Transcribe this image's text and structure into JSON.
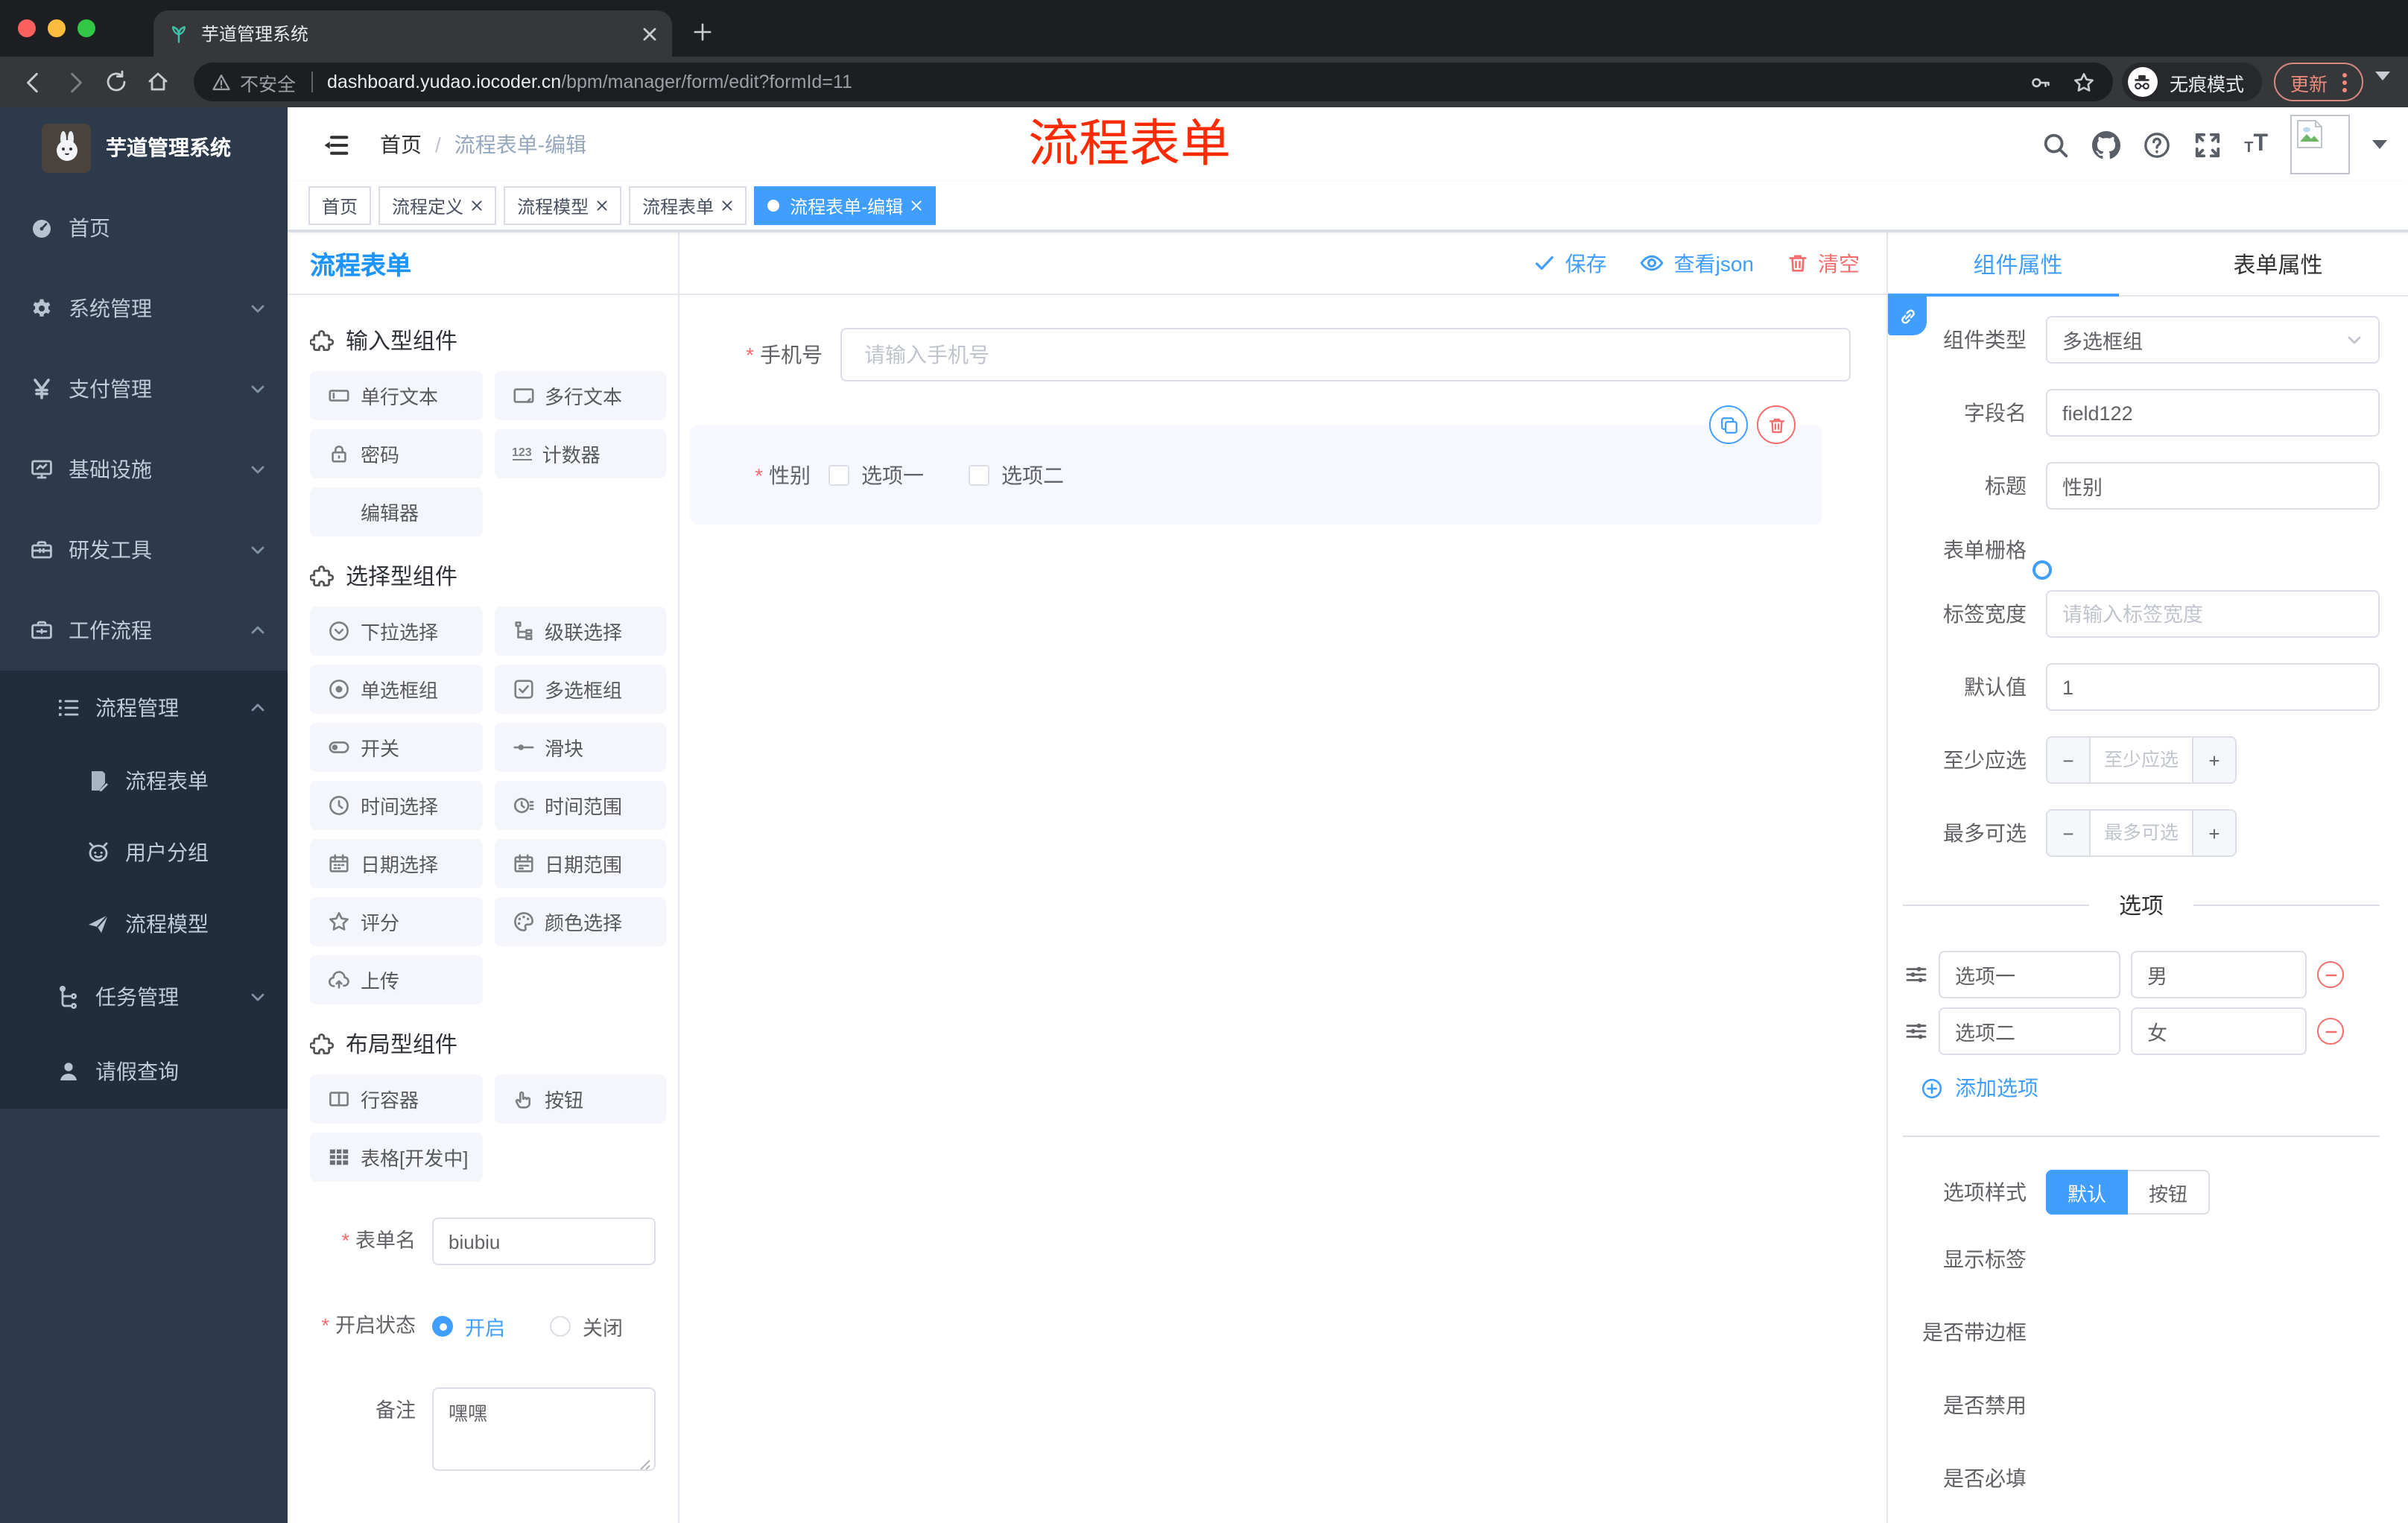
{
  "browser": {
    "tab_title": "芋道管理系统",
    "security_text": "不安全",
    "url_host": "dashboard.yudao.iocoder.cn",
    "url_path": "/bpm/manager/form/edit?formId=11",
    "incognito_text": "无痕模式",
    "update_text": "更新"
  },
  "sidebar": {
    "app_title": "芋道管理系统",
    "items": [
      {
        "label": "首页"
      },
      {
        "label": "系统管理"
      },
      {
        "label": "支付管理"
      },
      {
        "label": "基础设施"
      },
      {
        "label": "研发工具"
      },
      {
        "label": "工作流程"
      },
      {
        "label": "流程管理"
      },
      {
        "label": "流程表单"
      },
      {
        "label": "用户分组"
      },
      {
        "label": "流程模型"
      },
      {
        "label": "任务管理"
      },
      {
        "label": "请假查询"
      }
    ]
  },
  "header": {
    "breadcrumb_home": "首页",
    "breadcrumb_current": "流程表单-编辑",
    "watermark": "流程表单"
  },
  "tags": [
    {
      "label": "首页"
    },
    {
      "label": "流程定义"
    },
    {
      "label": "流程模型"
    },
    {
      "label": "流程表单"
    },
    {
      "label": "流程表单-编辑"
    }
  ],
  "palette": {
    "title": "流程表单",
    "groups": [
      {
        "title": "输入型组件",
        "items": [
          {
            "label": "单行文本"
          },
          {
            "label": "多行文本"
          },
          {
            "label": "密码"
          },
          {
            "label": "计数器"
          },
          {
            "label": "编辑器"
          }
        ]
      },
      {
        "title": "选择型组件",
        "items": [
          {
            "label": "下拉选择"
          },
          {
            "label": "级联选择"
          },
          {
            "label": "单选框组"
          },
          {
            "label": "多选框组"
          },
          {
            "label": "开关"
          },
          {
            "label": "滑块"
          },
          {
            "label": "时间选择"
          },
          {
            "label": "时间范围"
          },
          {
            "label": "日期选择"
          },
          {
            "label": "日期范围"
          },
          {
            "label": "评分"
          },
          {
            "label": "颜色选择"
          },
          {
            "label": "上传"
          }
        ]
      },
      {
        "title": "布局型组件",
        "items": [
          {
            "label": "行容器"
          },
          {
            "label": "按钮"
          },
          {
            "label": "表格[开发中]"
          }
        ]
      }
    ],
    "meta": {
      "form_name_label": "表单名",
      "form_name_value": "biubiu",
      "status_label": "开启状态",
      "status_on": "开启",
      "status_off": "关闭",
      "remark_label": "备注",
      "remark_value": "嘿嘿"
    }
  },
  "canvas": {
    "save_label": "保存",
    "view_json_label": "查看json",
    "clear_label": "清空",
    "phone_label": "手机号",
    "phone_placeholder": "请输入手机号",
    "gender_label": "性别",
    "gender_option1": "选项一",
    "gender_option2": "选项二"
  },
  "props": {
    "tab_component": "组件属性",
    "tab_form": "表单属性",
    "type_label": "组件类型",
    "type_value": "多选框组",
    "field_label": "字段名",
    "field_value": "field122",
    "title_label": "标题",
    "title_value": "性别",
    "grid_label": "表单栅格",
    "label_width_label": "标签宽度",
    "label_width_placeholder": "请输入标签宽度",
    "default_label": "默认值",
    "default_value": "1",
    "min_label": "至少应选",
    "min_placeholder": "至少应选",
    "max_label": "最多可选",
    "max_placeholder": "最多可选",
    "options_divider": "选项",
    "options": [
      {
        "label": "选项一",
        "value": "男"
      },
      {
        "label": "选项二",
        "value": "女"
      }
    ],
    "add_option_label": "添加选项",
    "style_label": "选项样式",
    "style_default": "默认",
    "style_button": "按钮",
    "toggle_show_label": "显示标签",
    "toggle_border_label": "是否带边框",
    "toggle_disabled_label": "是否禁用",
    "toggle_required_label": "是否必填"
  },
  "colors": {
    "primary": "#409eff",
    "danger": "#f56c6c",
    "watermark_red": "#ff2b00",
    "sidebar_bg": "#2d3a4b",
    "submenu_bg": "#1f2d3d"
  }
}
